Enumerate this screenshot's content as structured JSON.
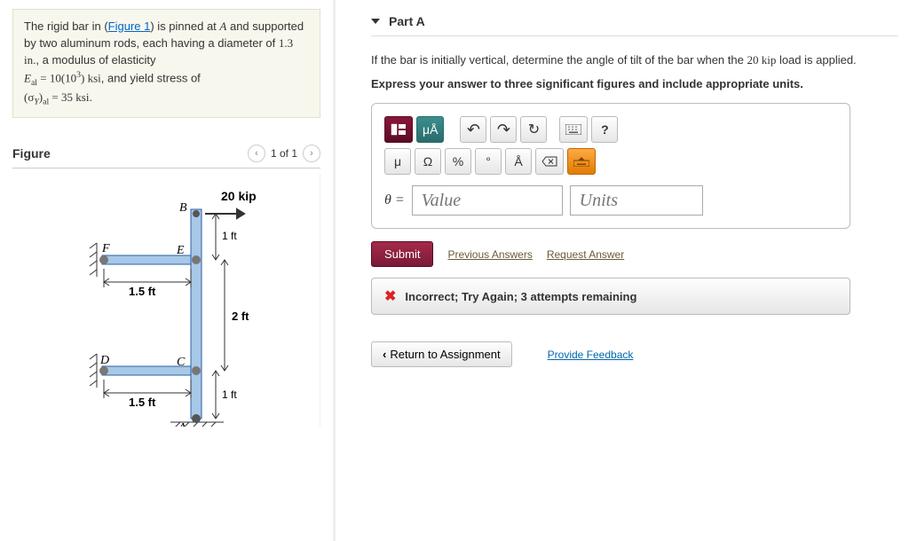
{
  "problem": {
    "pre_figure_text": "The rigid bar in (",
    "figure_link": "Figure 1",
    "post_figure_text": ") is pinned at ",
    "point_A": "A",
    "rods_text": " and supported by two aluminum rods, each having a diameter of ",
    "diameter": "1.3 in.",
    "modulus_label": ", a modulus of elasticity ",
    "E_symbol": "E",
    "E_sub": "al",
    "E_eq": " = 10(10",
    "E_exp": "3",
    "E_unit": ") ksi",
    "yield_pre": ", and yield stress of ",
    "sigma_open": "(σ",
    "sigma_Y": "Y",
    "sigma_close": ")",
    "sigma_sub": "al",
    "sigma_val": " = 35 ksi",
    "period": "."
  },
  "figure": {
    "title": "Figure",
    "counter": "1 of 1",
    "labels": {
      "load": "20 kip",
      "B": "B",
      "oneft_top": "1 ft",
      "F": "F",
      "E": "E",
      "onefive_top": "1.5 ft",
      "two_ft": "2 ft",
      "D": "D",
      "C": "C",
      "onefive_bot": "1.5 ft",
      "oneft_bot": "1 ft",
      "A": "A"
    }
  },
  "part": {
    "title": "Part A",
    "question_pre": "If the bar is initially vertical, determine the angle of tilt of the bar when the ",
    "load": "20 kip",
    "question_post": " load is applied.",
    "instructions": "Express your answer to three significant figures and include appropriate units.",
    "theta": "θ =",
    "value_ph": "Value",
    "units_ph": "Units",
    "submit": "Submit",
    "prev_answers": "Previous Answers",
    "request_answer": "Request Answer",
    "feedback": "Incorrect; Try Again; 3 attempts remaining"
  },
  "toolbar": {
    "mu_A": "μÅ",
    "undo": "↶",
    "redo": "↷",
    "reset": "↻",
    "help": "?",
    "mu": "μ",
    "omega": "Ω",
    "percent": "%",
    "degree": "°",
    "angstrom": "Å"
  },
  "footer": {
    "return": "Return to Assignment",
    "provide": "Provide Feedback"
  }
}
